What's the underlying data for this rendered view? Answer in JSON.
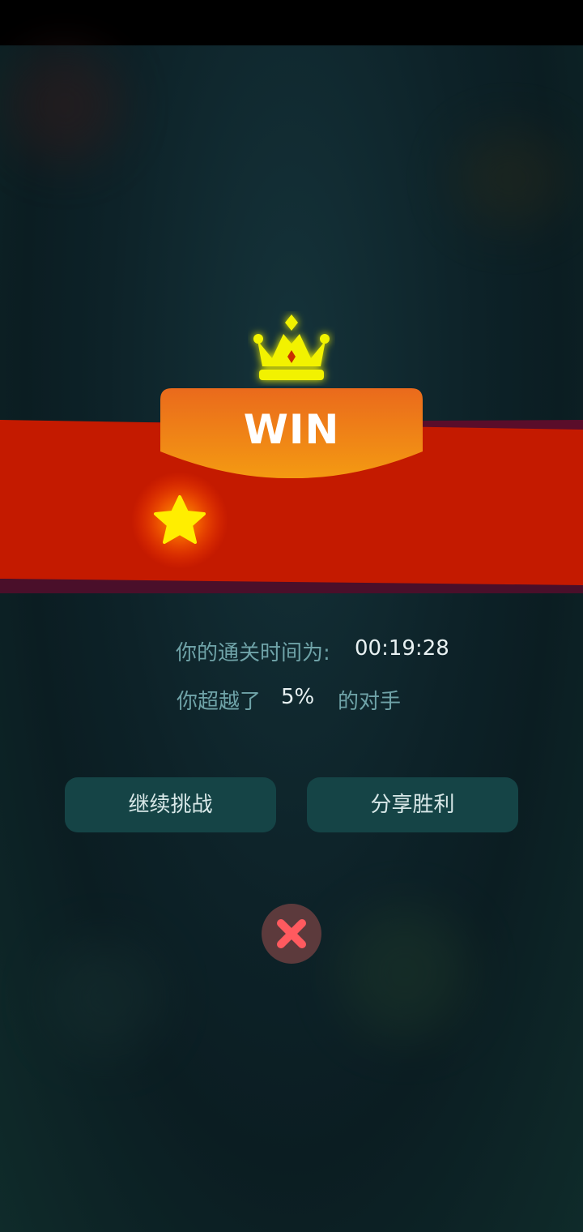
{
  "result": {
    "title": "WIN"
  },
  "stats": {
    "time_label": "你的通关时间为:",
    "time_value": "00:19:28",
    "beat_label": "你超越了",
    "beat_value": "5%",
    "beat_suffix": "的对手"
  },
  "rating": {
    "stars_earned": 1
  },
  "buttons": {
    "continue_label": "继续挑战",
    "share_label": "分享胜利"
  },
  "icons": {
    "crown": "crown-icon",
    "star": "star-icon",
    "close": "close-icon"
  },
  "colors": {
    "banner_red": "#c41a00",
    "plate_orange": "#f07a1a",
    "crown_yellow": "#f2f200",
    "star_yellow": "#ffee00",
    "button_bg": "#154446",
    "close_red": "#ff5a5f"
  }
}
